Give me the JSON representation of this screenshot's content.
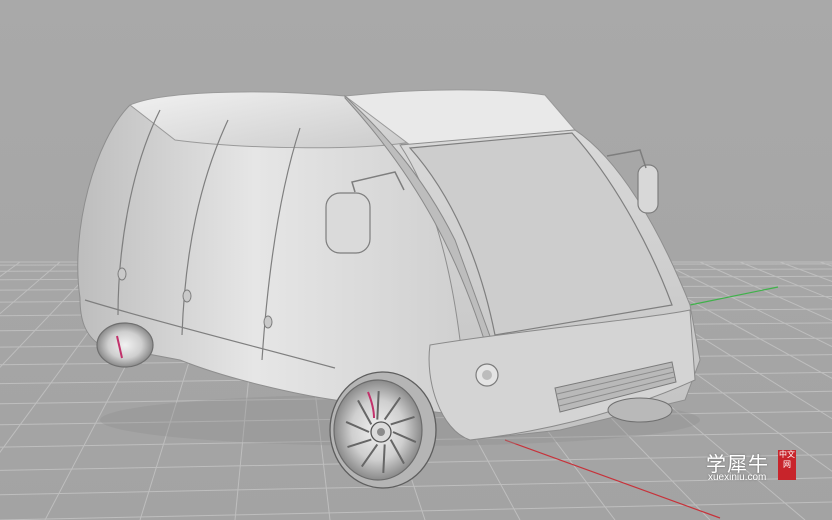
{
  "viewport": {
    "subject": "3D van model (shaded view)",
    "background_color": "#a8a8a8",
    "grid_color": "#bdbdbd",
    "axis_x_color": "#c7323a",
    "axis_y_color": "#3fb24a",
    "model_color": "#dcdcdc"
  },
  "watermark": {
    "chinese": "学犀牛",
    "domain": "xuexiniu.com",
    "badge": "中文网",
    "badge_color": "#c8242b"
  }
}
